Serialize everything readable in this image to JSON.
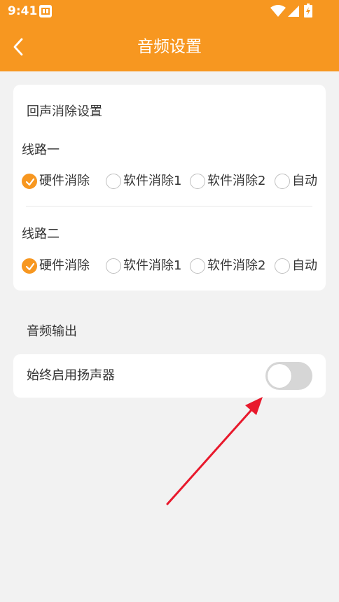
{
  "status_bar": {
    "time": "9:41",
    "icons": [
      "app-notification-icon",
      "wifi-icon",
      "signal-icon",
      "battery-icon"
    ]
  },
  "header": {
    "title": "音频设置",
    "back_icon": "chevron-left-icon"
  },
  "echo_cancellation": {
    "title": "回声消除设置",
    "lines": [
      {
        "label": "线路一",
        "options": [
          {
            "label": "硬件消除",
            "checked": true
          },
          {
            "label": "软件消除1",
            "checked": false
          },
          {
            "label": "软件消除2",
            "checked": false
          },
          {
            "label": "自动",
            "checked": false
          }
        ]
      },
      {
        "label": "线路二",
        "options": [
          {
            "label": "硬件消除",
            "checked": true
          },
          {
            "label": "软件消除1",
            "checked": false
          },
          {
            "label": "软件消除2",
            "checked": false
          },
          {
            "label": "自动",
            "checked": false
          }
        ]
      }
    ]
  },
  "audio_output": {
    "title": "音频输出",
    "speaker": {
      "label": "始终启用扬声器",
      "enabled": false
    }
  },
  "colors": {
    "accent": "#f79720",
    "background": "#f2f2f2",
    "card": "#ffffff",
    "text": "#333333",
    "toggle_off": "#d6d6d6",
    "arrow": "#e8192c"
  }
}
